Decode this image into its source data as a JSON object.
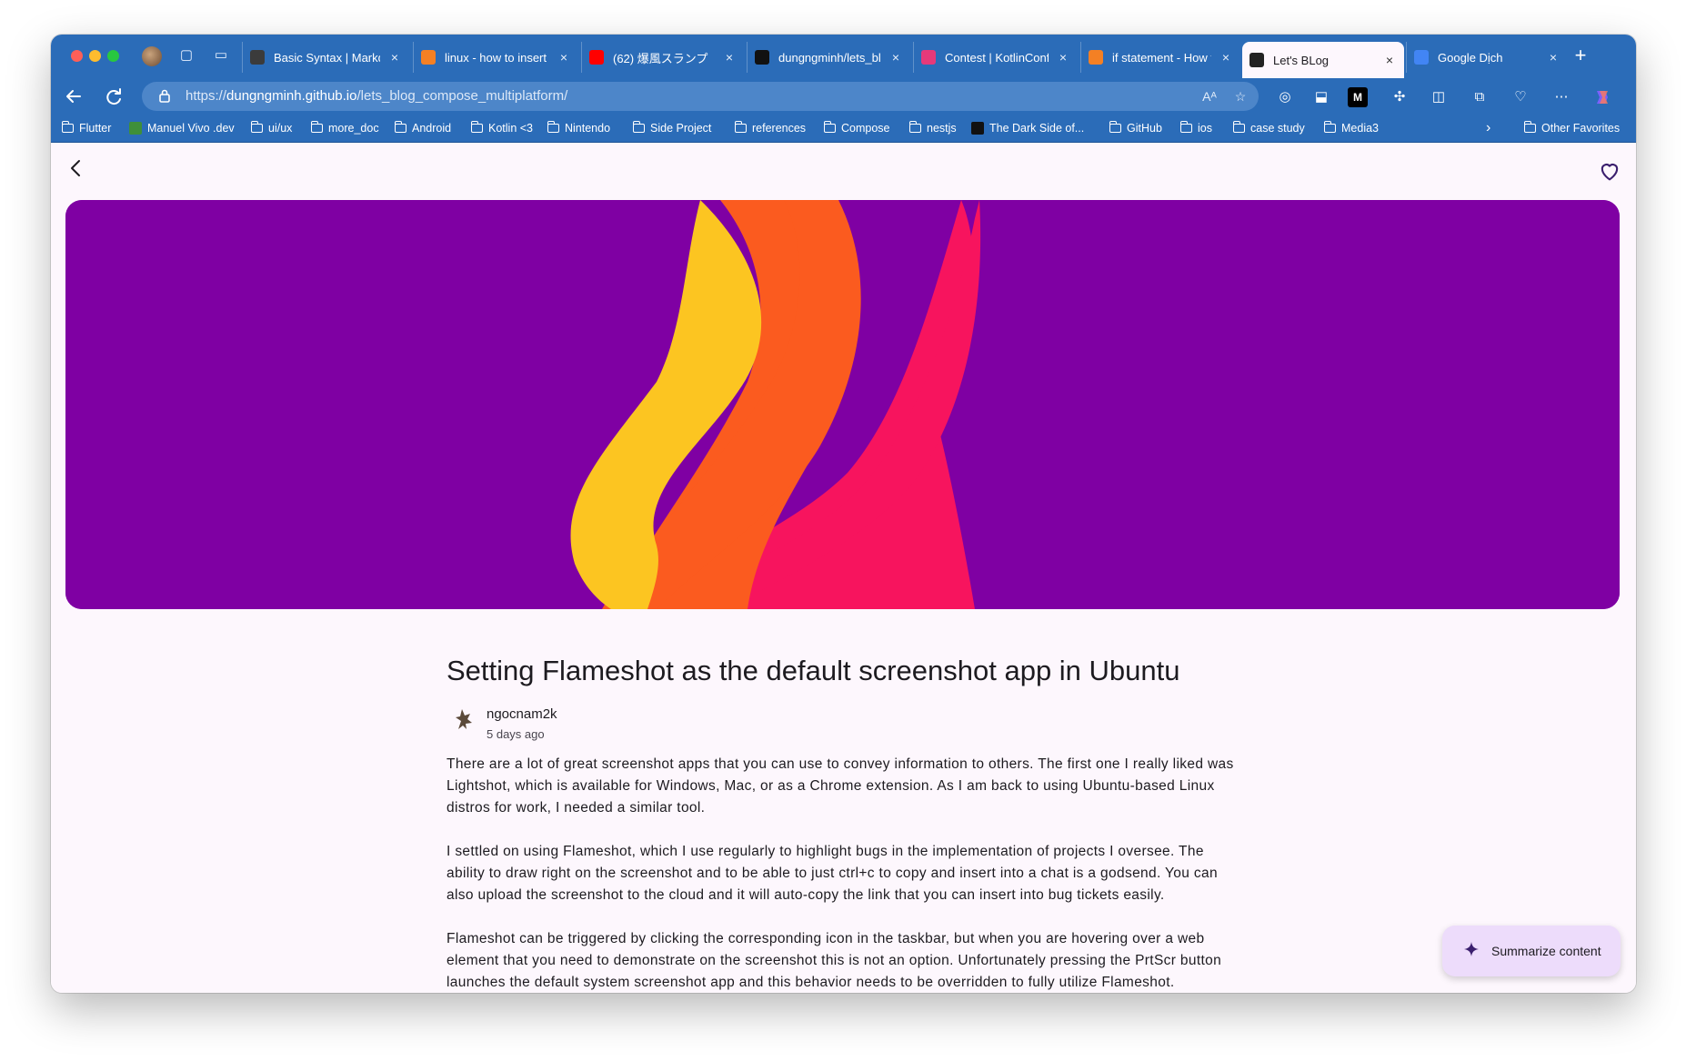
{
  "browser": {
    "tabs": [
      {
        "title": "Basic Syntax | Markdown",
        "favicon_color": "#3b3b3b",
        "active": false
      },
      {
        "title": "linux - how to insert",
        "favicon_color": "#f48024",
        "active": false
      },
      {
        "title": "(62) 爆風スランプ",
        "favicon_color": "#ff0000",
        "active": false
      },
      {
        "title": "dungngminh/lets_blog",
        "favicon_color": "#111111",
        "active": false
      },
      {
        "title": "Contest | KotlinConf",
        "favicon_color": "#e6397a",
        "active": false
      },
      {
        "title": "if statement - How to",
        "favicon_color": "#f48024",
        "active": false
      },
      {
        "title": "Let's BLog",
        "favicon_color": "#222222",
        "active": true
      },
      {
        "title": "Google Dịch",
        "favicon_color": "#4285f4",
        "active": false
      }
    ],
    "close_glyph": "×",
    "new_tab_glyph": "+",
    "url": {
      "scheme": "https://",
      "host": "dungngminh.github.io",
      "path": "/lets_blog_compose_multiplatform/"
    },
    "bookmarks": [
      {
        "label": "Flutter",
        "type": "folder"
      },
      {
        "label": "Manuel Vivo .dev",
        "type": "site",
        "color": "#3f8f3a"
      },
      {
        "label": "ui/ux",
        "type": "folder"
      },
      {
        "label": "more_doc",
        "type": "folder"
      },
      {
        "label": "Android",
        "type": "folder"
      },
      {
        "label": "Kotlin <3",
        "type": "folder"
      },
      {
        "label": "Nintendo",
        "type": "folder"
      },
      {
        "label": "Side Project",
        "type": "folder"
      },
      {
        "label": "references",
        "type": "folder"
      },
      {
        "label": "Compose",
        "type": "folder"
      },
      {
        "label": "nestjs",
        "type": "folder"
      },
      {
        "label": "The Dark Side of...",
        "type": "site",
        "color": "#111111"
      },
      {
        "label": "GitHub",
        "type": "folder"
      },
      {
        "label": "ios",
        "type": "folder"
      },
      {
        "label": "case study",
        "type": "folder"
      },
      {
        "label": "Media3",
        "type": "folder"
      }
    ],
    "bookmarks_more_glyph": "›",
    "other_favorites": "Other Favorites"
  },
  "article": {
    "title": "Setting Flameshot as the default screenshot app in Ubuntu",
    "author": "ngocnam2k",
    "time": "5 days ago",
    "paragraphs": [
      "There are a lot of great screenshot apps that you can use to convey information to others. The first one I really liked was Lightshot, which is available for Windows, Mac, or as a Chrome extension. As I am back to using Ubuntu-based Linux distros for work, I needed a similar tool.",
      "I settled on using Flameshot, which I use regularly to highlight bugs in the implementation of projects I oversee. The ability to draw right on the screenshot and to be able to just ctrl+c to copy and insert into a chat is a godsend. You can also upload the screenshot to the cloud and it will auto-copy the link that you can insert into bug tickets easily.",
      "Flameshot can be triggered by clicking the corresponding icon in the taskbar, but when you are hovering over a web element that you need to demonstrate on the screenshot this is not an option. Unfortunately pressing the PrtScr button launches the default system screenshot app and this behavior needs to be overridden to fully utilize Flameshot."
    ]
  },
  "summarize_button": {
    "label": "Summarize content"
  },
  "colors": {
    "hero_bg": "#7f00a3",
    "flame_yellow": "#fcc521",
    "flame_orange": "#fb5b1f",
    "flame_pink": "#f7145e",
    "accent": "#3b1f6e",
    "browser_chrome": "#2b6cb8"
  },
  "icons": {
    "back": "arrow-left-icon",
    "refresh": "refresh-icon",
    "favorite": "heart-outline-icon",
    "spark": "sparkle-icon"
  }
}
